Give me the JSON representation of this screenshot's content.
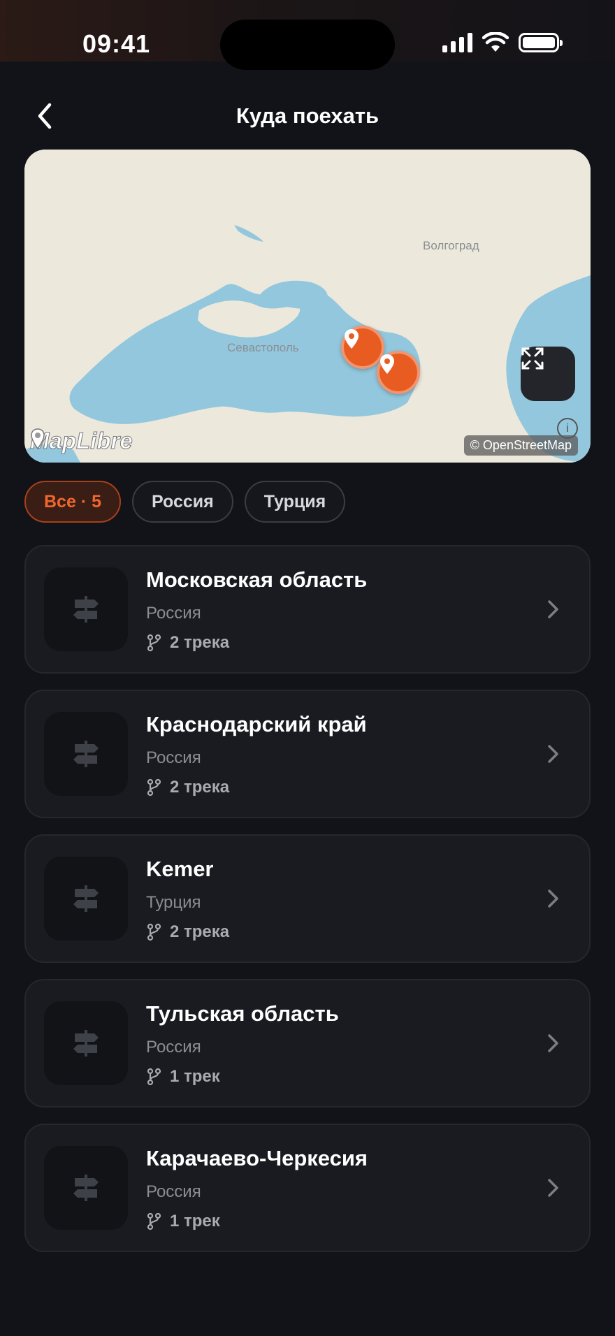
{
  "status": {
    "time": "09:41"
  },
  "header": {
    "title": "Куда поехать"
  },
  "map": {
    "cities": [
      "Волгоград",
      "Севастополь"
    ],
    "attribution": "© OpenStreetMap",
    "logo": "MapLibre",
    "markers": 2
  },
  "filters": [
    {
      "label": "Все · 5",
      "active": true
    },
    {
      "label": "Россия",
      "active": false
    },
    {
      "label": "Турция",
      "active": false
    }
  ],
  "destinations": [
    {
      "title": "Московская область",
      "country": "Россия",
      "tracks": "2 трека"
    },
    {
      "title": "Краснодарский край",
      "country": "Россия",
      "tracks": "2 трека"
    },
    {
      "title": "Kemer",
      "country": "Турция",
      "tracks": "2 трека"
    },
    {
      "title": "Тульская область",
      "country": "Россия",
      "tracks": "1 трек"
    },
    {
      "title": "Карачаево-Черкесия",
      "country": "Россия",
      "tracks": "1 трек"
    }
  ],
  "colors": {
    "accent": "#e85c22",
    "background": "#121318",
    "card": "#1a1b20",
    "water": "#93c7dd",
    "land": "#ece8dc"
  }
}
